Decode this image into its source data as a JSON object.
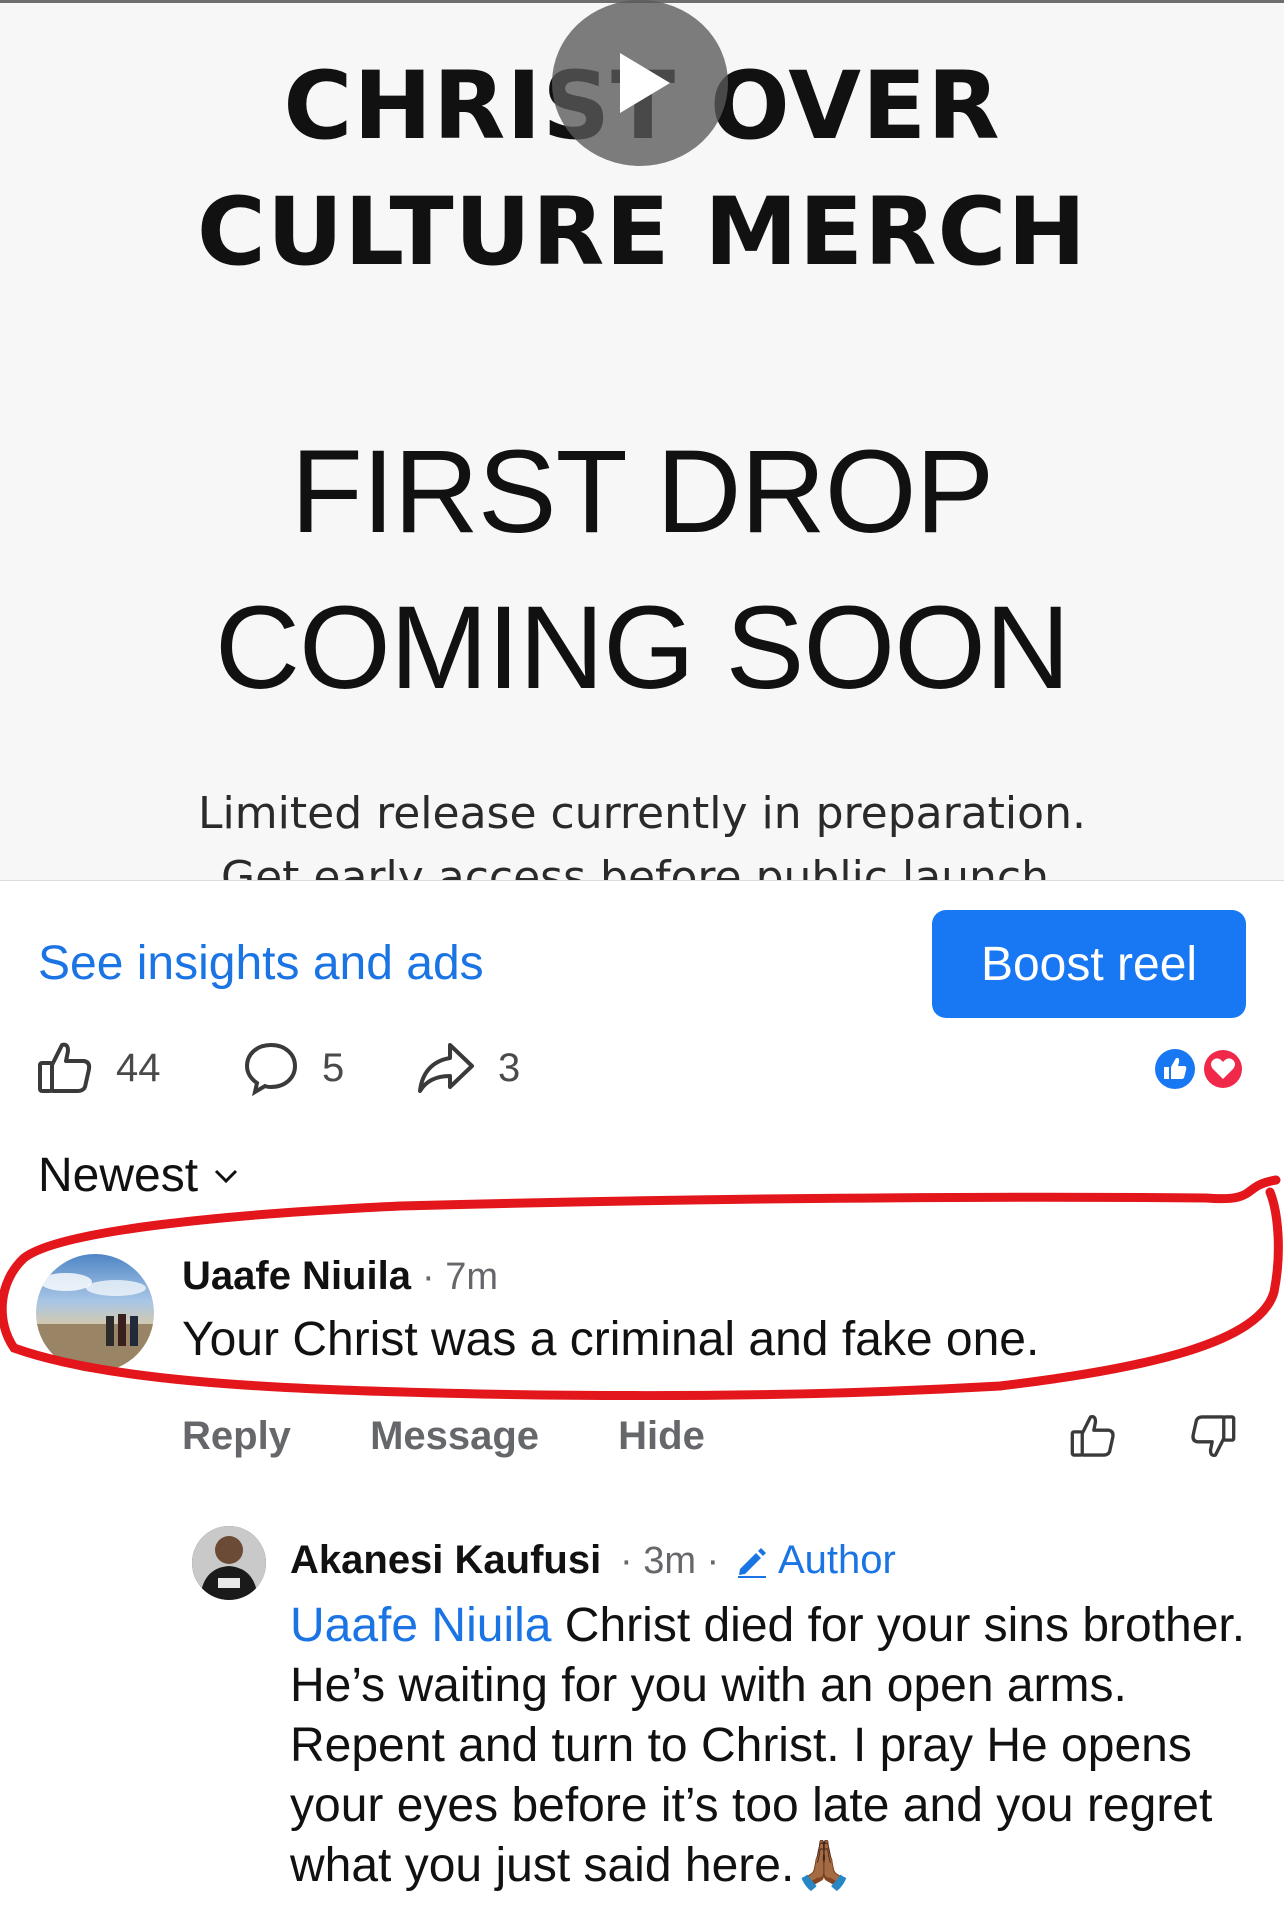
{
  "reel": {
    "brand_line1": "CHRIST OVER",
    "brand_line2": "CULTURE MERCH",
    "headline_line1": "FIRST DROP",
    "headline_line2": "COMING SOON",
    "sub_line1": "Limited release currently in preparation.",
    "sub_line2": "Get early access before public launch."
  },
  "actions": {
    "insights_link": "See insights and ads",
    "boost_button": "Boost reel"
  },
  "stats": {
    "likes": "44",
    "comments": "5",
    "shares": "3"
  },
  "sort": {
    "label": "Newest"
  },
  "comment": {
    "author": "Uaafe Niuila",
    "time": "· 7m",
    "text": "Your Christ was a criminal and fake one.",
    "reply_label": "Reply",
    "message_label": "Message",
    "hide_label": "Hide"
  },
  "reply": {
    "author": "Akanesi Kaufusi",
    "time": "· 3m ·",
    "badge": "Author",
    "mention": "Uaafe Niuila",
    "text": " Christ died for your sins brother. He’s waiting for you with an open arms. Repent and turn to Christ. I pray He opens your eyes before it’s too late and you regret what you just said here.🙏🏾"
  },
  "colors": {
    "accent": "#1877f2",
    "link": "#1b74e4",
    "highlight": "#e3161b",
    "heart": "#f0284a"
  }
}
